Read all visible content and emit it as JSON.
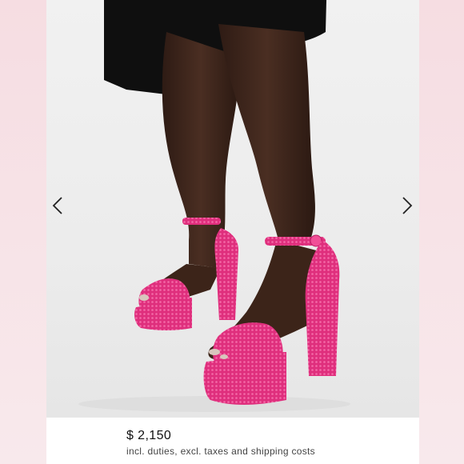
{
  "product": {
    "price": "$ 2,150",
    "price_note": "incl. duties, excl. taxes and shipping costs",
    "image_subject": "pink-crystal-platform-sandals"
  },
  "carousel": {
    "prev_icon": "chevron-left-icon",
    "next_icon": "chevron-right-icon"
  },
  "colors": {
    "background": "#f7e4e8",
    "card": "#ffffff",
    "shoe_pink": "#e0317f",
    "skirt": "#111111"
  }
}
